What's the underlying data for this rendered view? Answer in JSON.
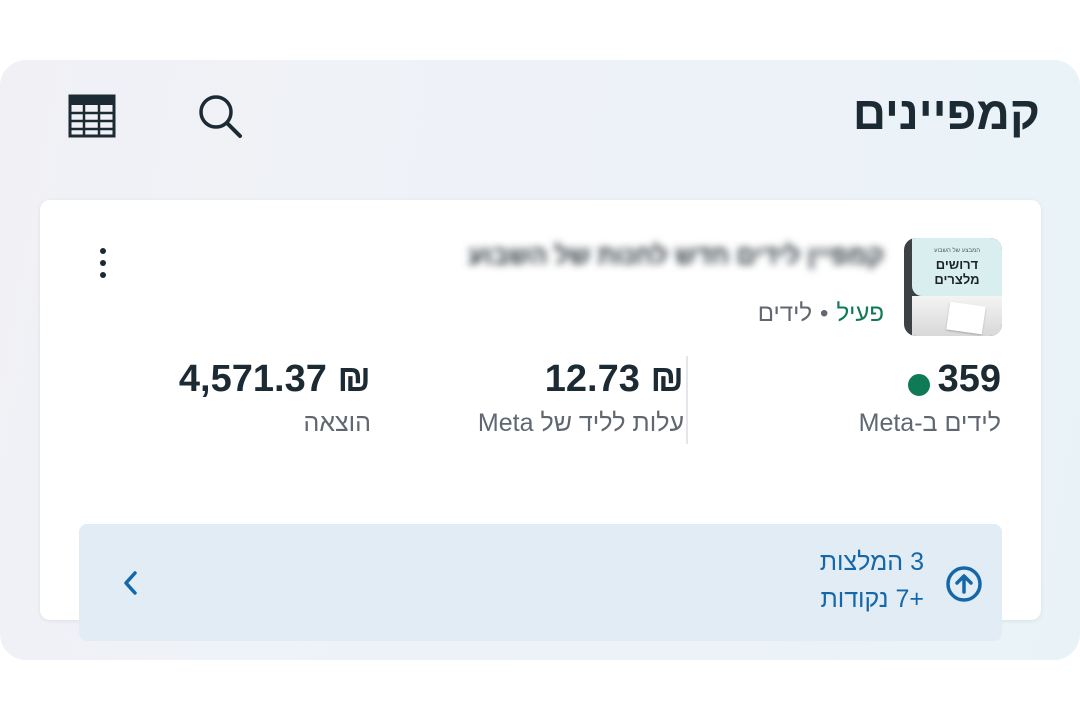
{
  "header": {
    "title": "קמפיינים",
    "icons": [
      "search-icon",
      "table-icon"
    ]
  },
  "campaign": {
    "thumbnail": {
      "small_text": "המבצע של השבוע",
      "text": "דרושים מלצרים"
    },
    "name_obscured": "קמפיין לידים חדש לחנות של השבוע",
    "status_active": "פעיל",
    "status_separator": "•",
    "objective": "לידים",
    "metrics": [
      {
        "value": "359",
        "label": "לידים ב-Meta"
      },
      {
        "value": "₪ 12.73",
        "label": "עלות לליד של Meta"
      },
      {
        "value": "₪ 4,571.37",
        "label": "הוצאה"
      }
    ]
  },
  "recommendations": {
    "line1": "3 המלצות",
    "line2": "+7 נקודות",
    "icon": "arrow-up-circle-icon",
    "chevron": "chevron-left-icon"
  },
  "colors": {
    "active_green": "#0f7a55",
    "reco_blue": "#1467a8",
    "reco_bg": "#e1ecf5"
  }
}
